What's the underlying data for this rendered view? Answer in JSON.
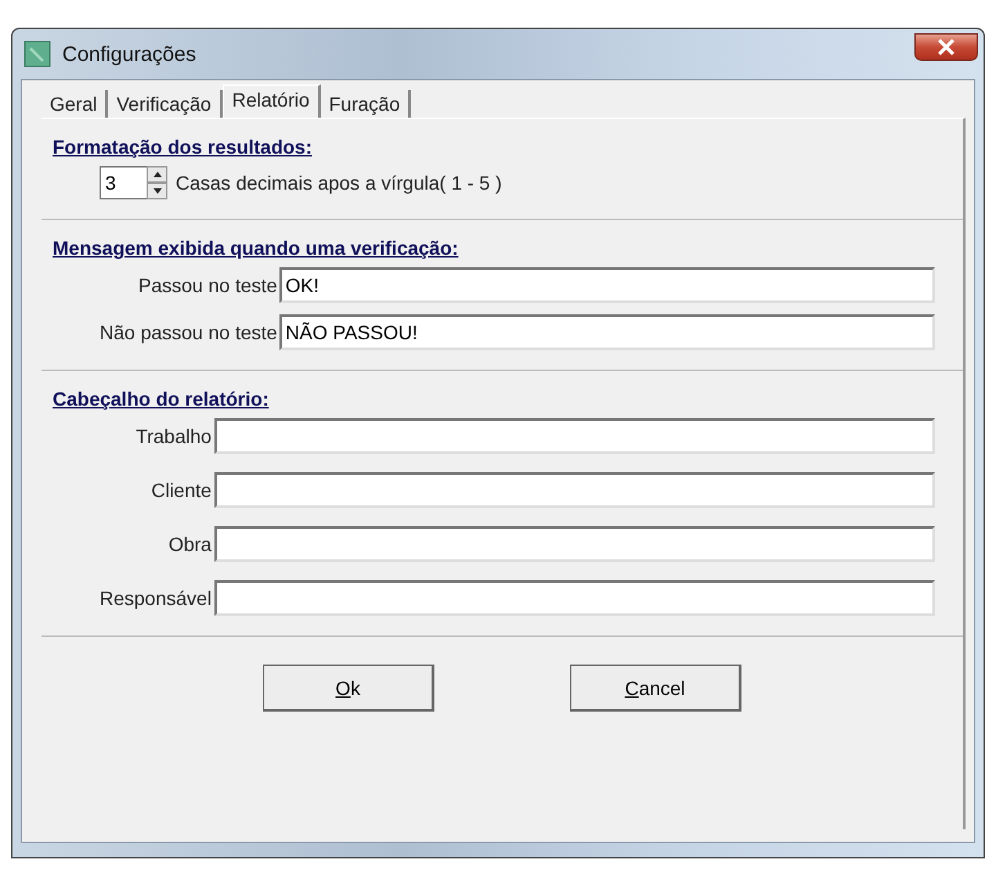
{
  "window": {
    "title": "Configurações"
  },
  "tabs": [
    {
      "label": "Geral",
      "selected": false
    },
    {
      "label": "Verificação",
      "selected": false
    },
    {
      "label": "Relatório",
      "selected": true
    },
    {
      "label": "Furação",
      "selected": false
    }
  ],
  "sections": [
    {
      "heading": "Formatação dos resultados:",
      "kind": "spinner",
      "value": "3",
      "label": "Casas decimais apos a vírgula( 1 - 5 )"
    },
    {
      "heading": "Mensagem exibida quando uma verificação:",
      "kind": "fields",
      "fields": [
        {
          "label": "Passou no teste",
          "value": "OK!"
        },
        {
          "label": "Não passou no teste",
          "value": "NÃO PASSOU!"
        }
      ]
    },
    {
      "heading": "Cabeçalho do relatório:",
      "kind": "fields",
      "fields": [
        {
          "label": "Trabalho"
        },
        {
          "label": "Cliente"
        },
        {
          "label": "Obra"
        },
        {
          "label": "Responsável"
        }
      ]
    }
  ],
  "buttons": [
    {
      "label": "Ok"
    },
    {
      "label": "Cancel"
    }
  ]
}
